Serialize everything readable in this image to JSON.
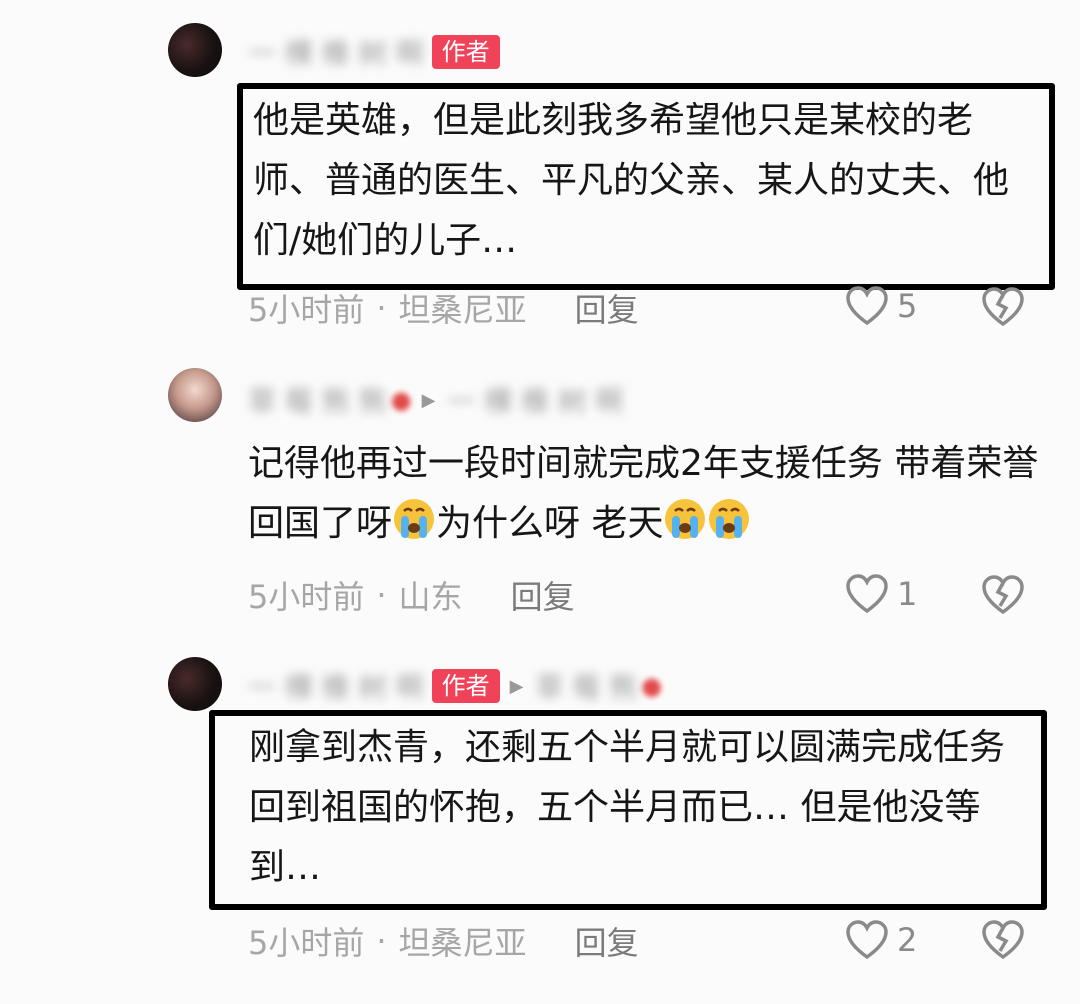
{
  "comments": [
    {
      "username": "一 棵 橡 树 啊",
      "author_badge": "作者",
      "text": "他是英雄，但是此刻我多希望他只是某校的老师、普通的医生、平凡的父亲、某人的丈夫、他们/她们的儿子…",
      "time": "5小时前",
      "location": "坦桑尼亚",
      "reply_label": "回复",
      "likes": "5"
    },
    {
      "username": "草 莓 熊 熊",
      "reply_to": "一 棵 橡 树 啊",
      "text_a": "记得他再过一段时间就完成2年支援任务 带着荣誉回国了呀",
      "text_b": "为什么呀 老天",
      "time": "5小时前",
      "location": "山东",
      "reply_label": "回复",
      "likes": "1"
    },
    {
      "username": "一 棵 橡 树 啊",
      "author_badge": "作者",
      "reply_to": "草 莓 熊",
      "text": "刚拿到杰青，还剩五个半月就可以圆满完成任务回到祖国的怀抱，五个半月而已… 但是他没等到…",
      "time": "5小时前",
      "location": "坦桑尼亚",
      "reply_label": "回复",
      "likes": "2"
    }
  ],
  "colors": {
    "author_badge": "#f0435a",
    "meta_text": "#a6a6a6",
    "box_border": "#000000"
  },
  "icons": {
    "like": "heart-outline-icon",
    "dislike": "broken-heart-icon",
    "crying": "crying-face-emoji",
    "reply_to": "triangle-right-icon"
  }
}
